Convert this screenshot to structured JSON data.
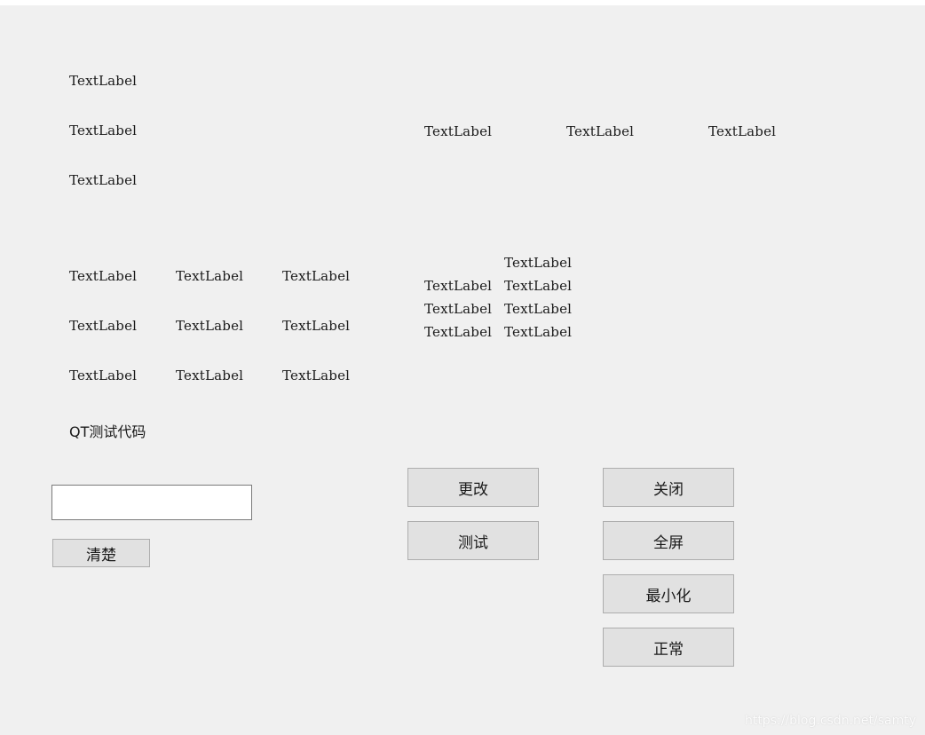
{
  "labels": {
    "col_a": [
      "TextLabel",
      "TextLabel",
      "TextLabel"
    ],
    "row_b": [
      "TextLabel",
      "TextLabel",
      "TextLabel"
    ],
    "grid_c": [
      [
        "TextLabel",
        "TextLabel",
        "TextLabel"
      ],
      [
        "TextLabel",
        "TextLabel",
        "TextLabel"
      ],
      [
        "TextLabel",
        "TextLabel",
        "TextLabel"
      ]
    ],
    "form_d": {
      "top": "TextLabel",
      "rows": [
        [
          "TextLabel",
          "TextLabel"
        ],
        [
          "TextLabel",
          "TextLabel"
        ],
        [
          "TextLabel",
          "TextLabel"
        ]
      ]
    },
    "qt_title": "QT测试代码"
  },
  "input": {
    "value": "",
    "placeholder": ""
  },
  "buttons": {
    "clear": "清楚",
    "change": "更改",
    "test": "测试",
    "close": "关闭",
    "fullscreen": "全屏",
    "minimize": "最小化",
    "normal": "正常"
  },
  "watermark": "https://blog.csdn.net/samty"
}
